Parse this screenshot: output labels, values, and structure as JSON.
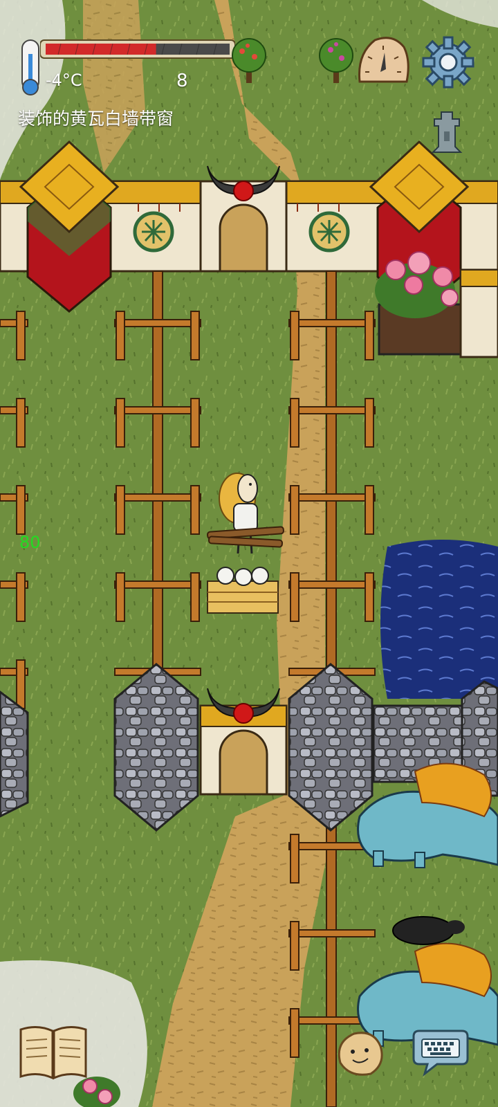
{
  "hud": {
    "temperature": "-4°C",
    "counter": "8",
    "status_text": "装饰的黄瓦白墙带窗",
    "fps": "80",
    "health_fraction": 0.6
  },
  "icons": {
    "thermometer": "thermometer-icon",
    "settings": "gear-icon",
    "clock": "sundial-clock-icon",
    "coin": "ancient-coin-icon",
    "book": "recipe-book-icon",
    "emote": "potato-face-icon",
    "keyboard": "chat-keyboard-icon",
    "trees": [
      "fruit-tree-icon",
      "fruit-tree-icon"
    ]
  },
  "colors": {
    "grass": "#6f8f3f",
    "path": "#c9a25a",
    "water": "#1b2f7a",
    "health_fill": "#d22a2a",
    "fps_text": "#22dd22"
  }
}
